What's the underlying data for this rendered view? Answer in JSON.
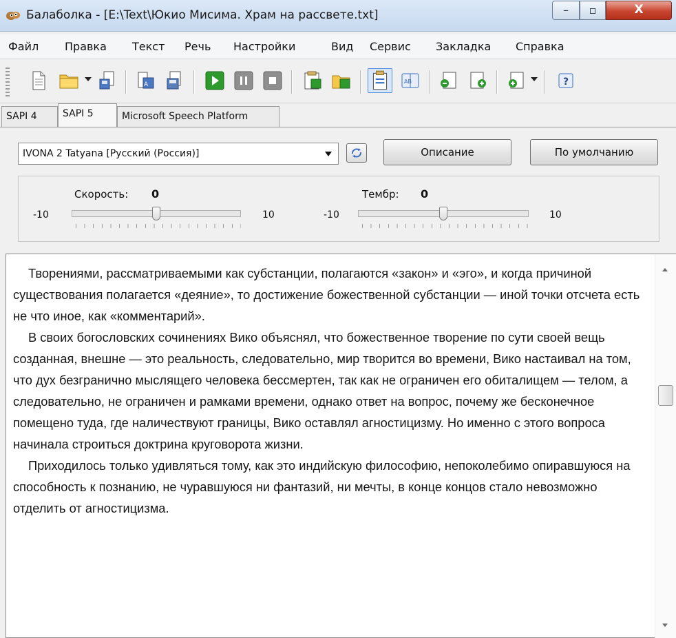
{
  "window": {
    "title": "Балаболка - [E:\\Text\\Юкио Мисима. Храм на рассвете.txt]",
    "icon": "balabolka-app-icon",
    "controls": {
      "minimize": "–",
      "maximize": "▫",
      "close": "X"
    }
  },
  "menu": [
    "Файл",
    "Правка",
    "Текст",
    "Речь",
    "Настройки",
    "Вид",
    "Сервис",
    "Закладка",
    "Справка"
  ],
  "toolbar": {
    "icons": [
      "new-document-icon",
      "open-folder-icon",
      "save-audio-icon",
      "convert-audio-icon",
      "save-file-icon",
      "play-icon",
      "pause-icon",
      "stop-icon",
      "speak-clipboard-icon",
      "read-clipboard-icon",
      "text-editor-icon",
      "dictionary-icon",
      "prev-bookmark-icon",
      "next-bookmark-icon",
      "bookmarks-icon",
      "help-icon"
    ]
  },
  "tabs": [
    "SAPI 4",
    "SAPI 5",
    "Microsoft Speech Platform"
  ],
  "selected_tab": "SAPI 5",
  "voice": {
    "selected": "IVONA 2 Tatyana [Русский (Россия)]",
    "describe_label": "Описание",
    "default_label": "По умолчанию"
  },
  "rate": {
    "label": "Скорость:",
    "value": "0",
    "min": "-10",
    "max": "10",
    "position_fraction": 0.5
  },
  "pitch": {
    "label": "Тембр:",
    "value": "0",
    "min": "-10",
    "max": "10",
    "position_fraction": 0.5
  },
  "text": {
    "paragraphs": [
      "Творениями, рассматриваемыми как субстанции, полагаются «закон» и «эго», и когда причиной существования полагается «деяние», то достижение божественной субстанции — иной точки отсчета есть не что иное, как «комментарий».",
      "В своих богословских сочинениях Вико объяснял, что божественное творение по сути своей вещь созданная, внешне — это реальность, следовательно, мир творится во времени, Вико настаивал на том, что дух безгранично мыслящего человека бессмертен, так как не ограничен его обиталищем — телом, а следовательно, не ограничен и рамками времени, однако ответ на вопрос, почему же бесконечное помещено туда, где наличествуют границы, Вико оставлял агностицизму. Но именно с этого вопроса начинала строиться доктрина круговорота жизни.",
      "Приходилось только удивляться тому, как это индийскую философию, непоколебимо опиравшуюся на способность к познанию, не чуравшуюся ни фантазий, ни мечты, в конце концов стало невозможно отделить от агностицизма."
    ]
  },
  "colors": {
    "titlebar": "#c7d9ef",
    "close_button": "#c8452f",
    "play_green": "#2e9a2e",
    "toolbar_bg": "#f0f0f0"
  }
}
